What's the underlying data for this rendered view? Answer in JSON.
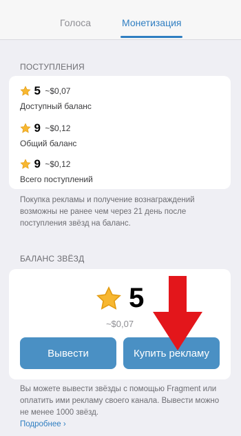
{
  "tabs": [
    {
      "label": "Голоса",
      "active": false
    },
    {
      "label": "Монетизация",
      "active": true
    }
  ],
  "income": {
    "header": "ПОСТУПЛЕНИЯ",
    "rows": [
      {
        "amount": "5",
        "approx": "~$0,07",
        "label": "Доступный баланс"
      },
      {
        "amount": "9",
        "approx": "~$0,12",
        "label": "Общий баланс"
      },
      {
        "amount": "9",
        "approx": "~$0,12",
        "label": "Всего поступлений"
      }
    ],
    "footnote": "Покупка рекламы и получение вознаграждений возможны не ранее чем через 21 день после поступления звёзд на баланс."
  },
  "balance": {
    "header": "БАЛАНС ЗВЁЗД",
    "amount": "5",
    "approx": "~$0,07",
    "withdraw_label": "Вывести",
    "buy_ads_label": "Купить рекламу",
    "footnote": "Вы можете вывести звёзды с помощью Fragment или оплатить ими рекламу своего канала. Вывести можно не менее 1000 звёзд.",
    "more_link": "Подробнее",
    "more_chevron": "›"
  },
  "colors": {
    "accent": "#2f7ec1",
    "button": "#4a90c4",
    "star": "#f7b731",
    "arrow": "#e3161b"
  },
  "icons": {
    "star": "star-icon",
    "arrow": "red-down-arrow"
  }
}
